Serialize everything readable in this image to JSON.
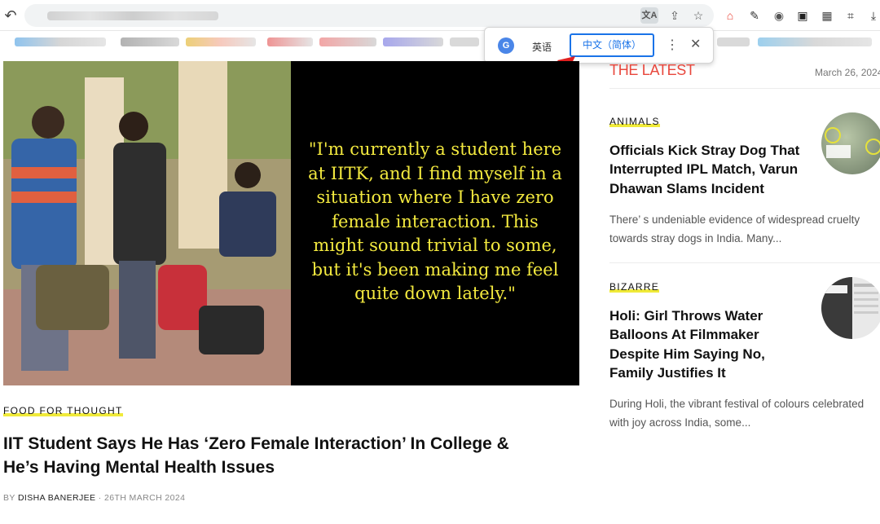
{
  "browser": {
    "icons": [
      "back-arrow-icon",
      "translate-icon",
      "share-icon",
      "star-icon",
      "extension-icons"
    ]
  },
  "translate_popup": {
    "source_lang": "英语",
    "target_lang": "中文（简体）",
    "more": "⋮",
    "close": "✕"
  },
  "hero": {
    "quote": "\"I'm currently a student here at IITK, and I find myself in a situation where I have zero female interaction. This might sound trivial to some, but it's been making me feel quite down lately.\"",
    "quote_color": "#f4ea3f"
  },
  "article": {
    "kicker": "FOOD FOR THOUGHT",
    "headline": "IIT Student Says He Has ‘Zero Female Interaction’ In College & He’s Having Mental Health Issues",
    "by": "BY",
    "author": "DISHA BANERJEE",
    "date": "· 26TH MARCH 2024"
  },
  "latest": {
    "title": "THE LATEST",
    "date": "March 26, 2024",
    "accent": "#e8473c",
    "cards": [
      {
        "kicker": "ANIMALS",
        "title": "Officials Kick Stray Dog That Interrupted IPL Match, Varun Dhawan Slams Incident",
        "excerpt": "There’ s undeniable evidence of widespread cruelty towards stray dogs in India. Many..."
      },
      {
        "kicker": "BIZARRE",
        "title": "Holi: Girl Throws Water Balloons At Filmmaker Despite Him Saying No, Family Justifies It",
        "excerpt": "During Holi, the vibrant festival of colours celebrated with joy across India, some..."
      }
    ]
  }
}
